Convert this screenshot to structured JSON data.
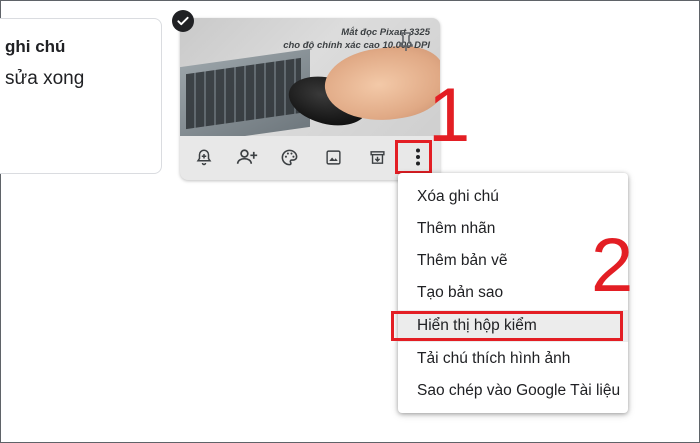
{
  "left_note": {
    "title": "ghi chú",
    "body": "sửa xong"
  },
  "image_note": {
    "ad_line1": "Mắt đọc Pixart 3325",
    "ad_line2": "cho độ chính xác cao 10.000 DPI",
    "selected": true
  },
  "toolbar": {
    "icons": [
      "bell-plus-icon",
      "add-collaborator-icon",
      "palette-icon",
      "image-icon",
      "archive-icon",
      "more-vert-icon"
    ]
  },
  "annotations": {
    "step1": "1",
    "step2": "2",
    "highlight_color": "#e31e24"
  },
  "menu": {
    "items": [
      {
        "label": "Xóa ghi chú"
      },
      {
        "label": "Thêm nhãn"
      },
      {
        "label": "Thêm bản vẽ"
      },
      {
        "label": "Tạo bản sao"
      },
      {
        "label": "Hiển thị hộp kiểm"
      },
      {
        "label": "Tải chú thích hình ảnh"
      },
      {
        "label": "Sao chép vào Google Tài liệu"
      }
    ],
    "hovered_index": 4
  }
}
